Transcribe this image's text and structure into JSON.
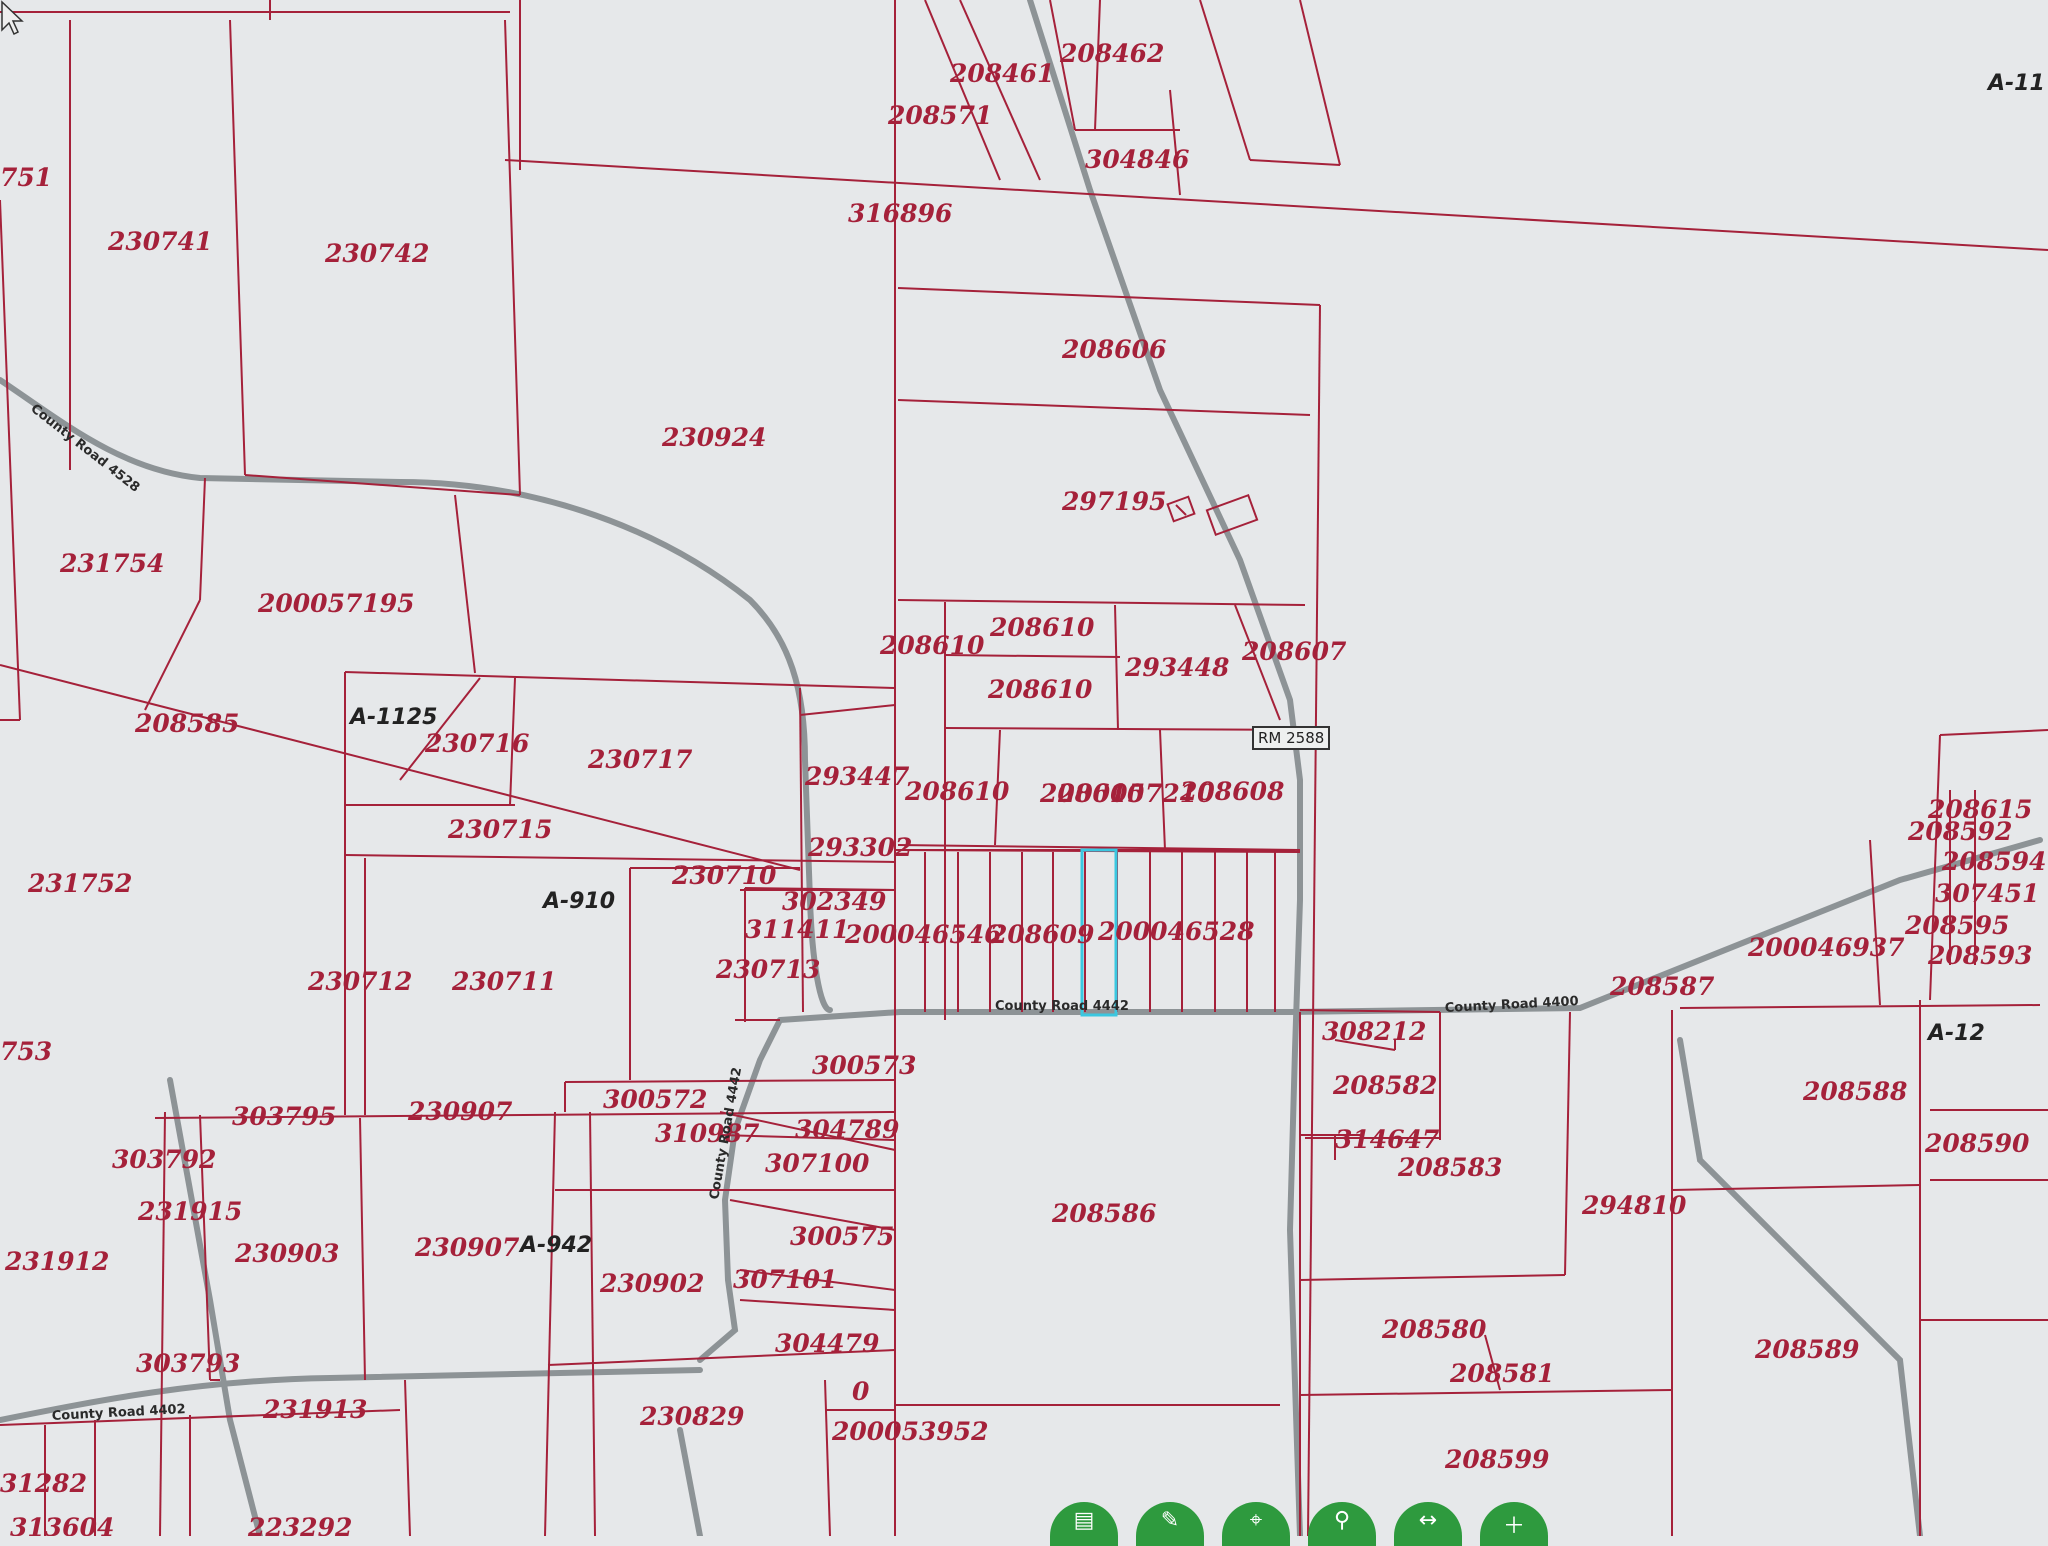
{
  "map": {
    "parcel_ids": [
      "208461",
      "208462",
      "208571",
      "304846",
      "316896",
      "230741",
      "230742",
      "751",
      "230924",
      "208606",
      "297195",
      "231754",
      "200057195",
      "208610",
      "208610",
      "208610",
      "208610",
      "208610",
      "293448",
      "208607",
      "208585",
      "A-1125",
      "230716",
      "230717",
      "200057210",
      "293447",
      "208608",
      "230715",
      "293302",
      "231752",
      "230710",
      "302349",
      "311411",
      "200046546",
      "208609",
      "200046528",
      "230713",
      "230712",
      "230711",
      "300573",
      "753",
      "300572",
      "303795",
      "230907",
      "310987",
      "304789",
      "303792",
      "307100",
      "231915",
      "230903",
      "230907",
      "300575",
      "231912",
      "230902",
      "307101",
      "304479",
      "303793",
      "231913",
      "0",
      "230829",
      "200053952",
      "31282",
      "313604",
      "223292",
      "208615",
      "208592",
      "208594",
      "307451",
      "208595",
      "208593",
      "200046937",
      "208587",
      "A-12",
      "208588",
      "308212",
      "208582",
      "314647",
      "208583",
      "208590",
      "294810",
      "208586",
      "208580",
      "208581",
      "208589",
      "208599"
    ],
    "abstracts": [
      "A-11",
      "A-1125",
      "A-910",
      "A-942",
      "A-12"
    ],
    "roads": [
      "County Road 4528",
      "County Road 4442",
      "County Road 4400",
      "County Road 4402",
      "County Road 4442"
    ],
    "highway_shield": "RM 2588",
    "toolbar_icons": [
      "layers-icon",
      "edit-icon",
      "locate-icon",
      "search-icon",
      "measure-icon",
      "add-icon"
    ],
    "colors": {
      "parcel_line": "#a5213a",
      "road": "#8d9396",
      "selection": "#3bc7e0",
      "toolbar": "#2e9a3e"
    }
  }
}
